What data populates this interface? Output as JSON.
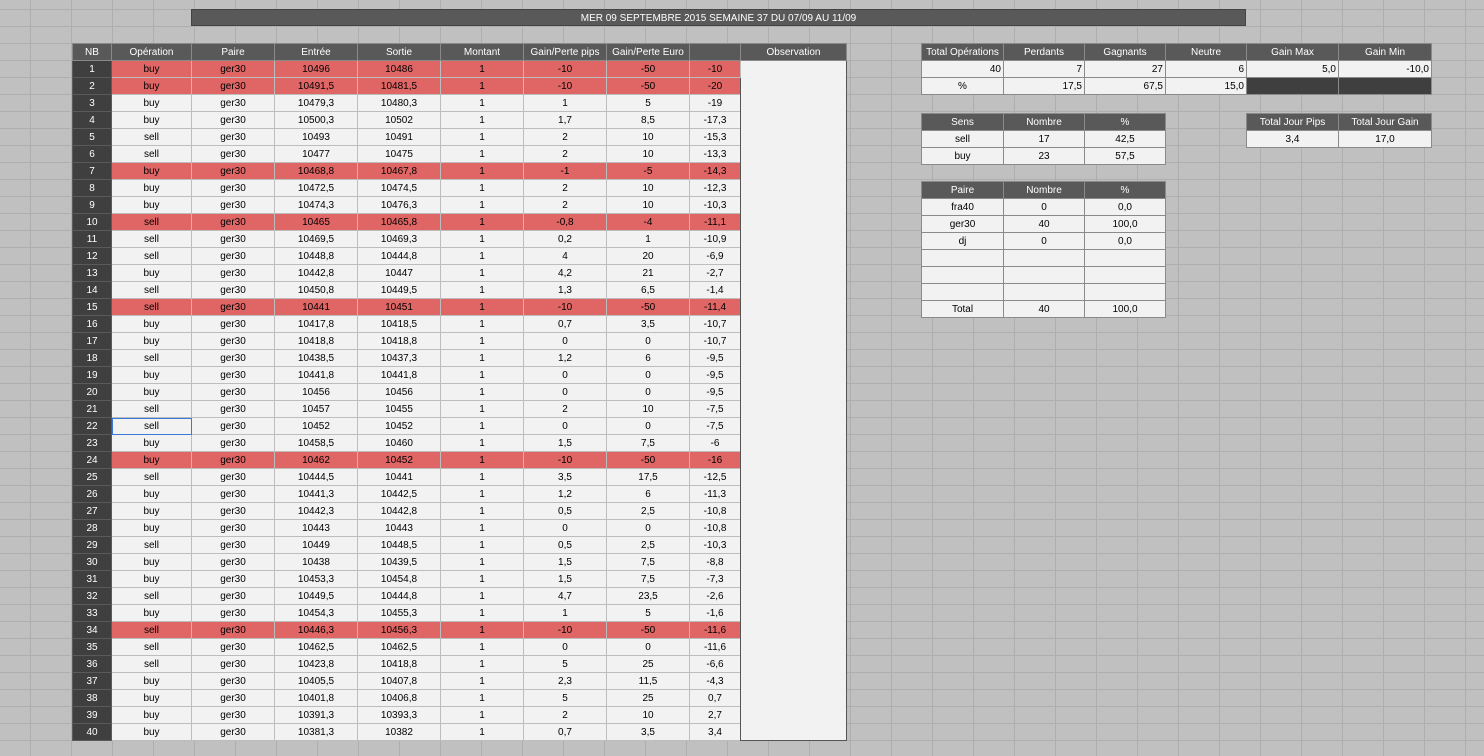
{
  "banner": "MER 09 SEPTEMBRE 2015 SEMAINE 37 DU 07/09 AU 11/09",
  "trades": {
    "headers": [
      "NB",
      "Opération",
      "Paire",
      "Entrée",
      "Sortie",
      "Montant",
      "Gain/Perte pips",
      "Gain/Perte Euro",
      "",
      "Observation"
    ],
    "rows": [
      [
        "1",
        "buy",
        "ger30",
        "10496",
        "10486",
        "1",
        "-10",
        "-50",
        "-10"
      ],
      [
        "2",
        "buy",
        "ger30",
        "10491,5",
        "10481,5",
        "1",
        "-10",
        "-50",
        "-20"
      ],
      [
        "3",
        "buy",
        "ger30",
        "10479,3",
        "10480,3",
        "1",
        "1",
        "5",
        "-19"
      ],
      [
        "4",
        "buy",
        "ger30",
        "10500,3",
        "10502",
        "1",
        "1,7",
        "8,5",
        "-17,3"
      ],
      [
        "5",
        "sell",
        "ger30",
        "10493",
        "10491",
        "1",
        "2",
        "10",
        "-15,3"
      ],
      [
        "6",
        "sell",
        "ger30",
        "10477",
        "10475",
        "1",
        "2",
        "10",
        "-13,3"
      ],
      [
        "7",
        "buy",
        "ger30",
        "10468,8",
        "10467,8",
        "1",
        "-1",
        "-5",
        "-14,3"
      ],
      [
        "8",
        "buy",
        "ger30",
        "10472,5",
        "10474,5",
        "1",
        "2",
        "10",
        "-12,3"
      ],
      [
        "9",
        "buy",
        "ger30",
        "10474,3",
        "10476,3",
        "1",
        "2",
        "10",
        "-10,3"
      ],
      [
        "10",
        "sell",
        "ger30",
        "10465",
        "10465,8",
        "1",
        "-0,8",
        "-4",
        "-11,1"
      ],
      [
        "11",
        "sell",
        "ger30",
        "10469,5",
        "10469,3",
        "1",
        "0,2",
        "1",
        "-10,9"
      ],
      [
        "12",
        "sell",
        "ger30",
        "10448,8",
        "10444,8",
        "1",
        "4",
        "20",
        "-6,9"
      ],
      [
        "13",
        "buy",
        "ger30",
        "10442,8",
        "10447",
        "1",
        "4,2",
        "21",
        "-2,7"
      ],
      [
        "14",
        "sell",
        "ger30",
        "10450,8",
        "10449,5",
        "1",
        "1,3",
        "6,5",
        "-1,4"
      ],
      [
        "15",
        "sell",
        "ger30",
        "10441",
        "10451",
        "1",
        "-10",
        "-50",
        "-11,4"
      ],
      [
        "16",
        "buy",
        "ger30",
        "10417,8",
        "10418,5",
        "1",
        "0,7",
        "3,5",
        "-10,7"
      ],
      [
        "17",
        "buy",
        "ger30",
        "10418,8",
        "10418,8",
        "1",
        "0",
        "0",
        "-10,7"
      ],
      [
        "18",
        "sell",
        "ger30",
        "10438,5",
        "10437,3",
        "1",
        "1,2",
        "6",
        "-9,5"
      ],
      [
        "19",
        "buy",
        "ger30",
        "10441,8",
        "10441,8",
        "1",
        "0",
        "0",
        "-9,5"
      ],
      [
        "20",
        "buy",
        "ger30",
        "10456",
        "10456",
        "1",
        "0",
        "0",
        "-9,5"
      ],
      [
        "21",
        "sell",
        "ger30",
        "10457",
        "10455",
        "1",
        "2",
        "10",
        "-7,5"
      ],
      [
        "22",
        "sell",
        "ger30",
        "10452",
        "10452",
        "1",
        "0",
        "0",
        "-7,5"
      ],
      [
        "23",
        "buy",
        "ger30",
        "10458,5",
        "10460",
        "1",
        "1,5",
        "7,5",
        "-6"
      ],
      [
        "24",
        "buy",
        "ger30",
        "10462",
        "10452",
        "1",
        "-10",
        "-50",
        "-16"
      ],
      [
        "25",
        "sell",
        "ger30",
        "10444,5",
        "10441",
        "1",
        "3,5",
        "17,5",
        "-12,5"
      ],
      [
        "26",
        "buy",
        "ger30",
        "10441,3",
        "10442,5",
        "1",
        "1,2",
        "6",
        "-11,3"
      ],
      [
        "27",
        "buy",
        "ger30",
        "10442,3",
        "10442,8",
        "1",
        "0,5",
        "2,5",
        "-10,8"
      ],
      [
        "28",
        "buy",
        "ger30",
        "10443",
        "10443",
        "1",
        "0",
        "0",
        "-10,8"
      ],
      [
        "29",
        "sell",
        "ger30",
        "10449",
        "10448,5",
        "1",
        "0,5",
        "2,5",
        "-10,3"
      ],
      [
        "30",
        "buy",
        "ger30",
        "10438",
        "10439,5",
        "1",
        "1,5",
        "7,5",
        "-8,8"
      ],
      [
        "31",
        "buy",
        "ger30",
        "10453,3",
        "10454,8",
        "1",
        "1,5",
        "7,5",
        "-7,3"
      ],
      [
        "32",
        "sell",
        "ger30",
        "10449,5",
        "10444,8",
        "1",
        "4,7",
        "23,5",
        "-2,6"
      ],
      [
        "33",
        "buy",
        "ger30",
        "10454,3",
        "10455,3",
        "1",
        "1",
        "5",
        "-1,6"
      ],
      [
        "34",
        "sell",
        "ger30",
        "10446,3",
        "10456,3",
        "1",
        "-10",
        "-50",
        "-11,6"
      ],
      [
        "35",
        "sell",
        "ger30",
        "10462,5",
        "10462,5",
        "1",
        "0",
        "0",
        "-11,6"
      ],
      [
        "36",
        "sell",
        "ger30",
        "10423,8",
        "10418,8",
        "1",
        "5",
        "25",
        "-6,6"
      ],
      [
        "37",
        "buy",
        "ger30",
        "10405,5",
        "10407,8",
        "1",
        "2,3",
        "11,5",
        "-4,3"
      ],
      [
        "38",
        "buy",
        "ger30",
        "10401,8",
        "10406,8",
        "1",
        "5",
        "25",
        "0,7"
      ],
      [
        "39",
        "buy",
        "ger30",
        "10391,3",
        "10393,3",
        "1",
        "2",
        "10",
        "2,7"
      ],
      [
        "40",
        "buy",
        "ger30",
        "10381,3",
        "10382",
        "1",
        "0,7",
        "3,5",
        "3,4"
      ]
    ]
  },
  "summary": {
    "headers": [
      "Total Opérations",
      "Perdants",
      "Gagnants",
      "Neutre",
      "Gain Max",
      "Gain Min"
    ],
    "counts": [
      "40",
      "7",
      "27",
      "6",
      "5,0",
      "-10,0"
    ],
    "pct_label": "%",
    "pcts": [
      "17,5",
      "67,5",
      "15,0"
    ]
  },
  "sens": {
    "headers": [
      "Sens",
      "Nombre",
      "%"
    ],
    "rows": [
      [
        "sell",
        "17",
        "42,5"
      ],
      [
        "buy",
        "23",
        "57,5"
      ]
    ]
  },
  "total_jour": {
    "headers": [
      "Total Jour Pips",
      "Total Jour Gain"
    ],
    "values": [
      "3,4",
      "17,0"
    ]
  },
  "paires": {
    "headers": [
      "Paire",
      "Nombre",
      "%"
    ],
    "rows": [
      [
        "fra40",
        "0",
        "0,0"
      ],
      [
        "ger30",
        "40",
        "100,0"
      ],
      [
        "dj",
        "0",
        "0,0"
      ],
      [
        "",
        "",
        ""
      ],
      [
        "",
        "",
        ""
      ],
      [
        "",
        "",
        ""
      ]
    ],
    "total": [
      "Total",
      "40",
      "100,0"
    ]
  },
  "colors": {
    "loss_row": "#e06666",
    "header_bg": "#595959",
    "nb_bg": "#3f3f3f",
    "selection": "#3c78d8"
  }
}
